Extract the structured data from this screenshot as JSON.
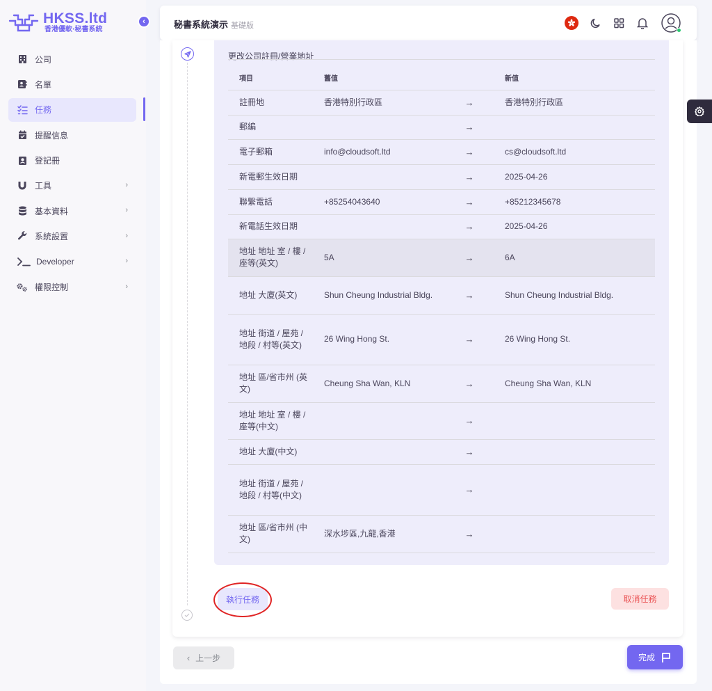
{
  "brand": {
    "name": "HKSS.ltd",
    "subtitle": "香港優軟‧秘書系統"
  },
  "sidebar": {
    "items": [
      {
        "label": "公司",
        "icon": "building-icon",
        "has_children": false
      },
      {
        "label": "名單",
        "icon": "contact-card-icon",
        "has_children": false
      },
      {
        "label": "任務",
        "icon": "checklist-icon",
        "has_children": false,
        "active": true
      },
      {
        "label": "提醒信息",
        "icon": "calendar-check-icon",
        "has_children": false
      },
      {
        "label": "登記冊",
        "icon": "register-book-icon",
        "has_children": false
      },
      {
        "label": "工具",
        "icon": "magnet-icon",
        "has_children": true
      },
      {
        "label": "基本資料",
        "icon": "database-icon",
        "has_children": true
      },
      {
        "label": "系統設置",
        "icon": "wrench-icon",
        "has_children": true
      },
      {
        "label": "Developer",
        "icon": "terminal-icon",
        "has_children": true
      },
      {
        "label": "權限控制",
        "icon": "gears-icon",
        "has_children": true
      }
    ]
  },
  "navbar": {
    "title": "秘書系統演示",
    "version": "基礎版"
  },
  "panel": {
    "title": "更改公司註冊/營業地址",
    "columns": {
      "item": "項目",
      "old": "舊值",
      "new": "新值"
    },
    "arrow": "→",
    "rows": [
      {
        "item": "註冊地",
        "old": "香港特別行政區",
        "new": "香港特別行政區"
      },
      {
        "item": "郵編",
        "old": "",
        "new": ""
      },
      {
        "item": "電子郵箱",
        "old": "info@cloudsoft.ltd",
        "new": "cs@cloudsoft.ltd"
      },
      {
        "item": "新電郵生效日期",
        "old": "",
        "new": "2025-04-26"
      },
      {
        "item": "聯繫電話",
        "old": "+85254043640",
        "new": "+85212345678"
      },
      {
        "item": "新電話生效日期",
        "old": "",
        "new": "2025-04-26"
      },
      {
        "item": "地址 地址 室 / 樓 / 座等(英文)",
        "old": "5A",
        "new": "6A",
        "highlighted": true
      },
      {
        "item": "地址 大廈(英文)",
        "old": "Shun Cheung Industrial Bldg.",
        "new": "Shun Cheung Industrial Bldg."
      },
      {
        "item": "地址 街道 / 屋苑 / 地段 / 村等(英文)",
        "old": "26 Wing Hong St.",
        "new": "26 Wing Hong St."
      },
      {
        "item": "地址 區/省市州 (英文)",
        "old": "Cheung Sha Wan, KLN",
        "new": "Cheung Sha Wan, KLN"
      },
      {
        "item": "地址 地址 室 / 樓 / 座等(中文)",
        "old": "",
        "new": ""
      },
      {
        "item": "地址 大廈(中文)",
        "old": "",
        "new": ""
      },
      {
        "item": "地址 街道 / 屋苑 / 地段 / 村等(中文)",
        "old": "",
        "new": ""
      },
      {
        "item": "地址 區/省市州 (中文)",
        "old": "深水埗區,九龍,香港",
        "new": ""
      }
    ]
  },
  "actions": {
    "execute": "執行任務",
    "cancel": "取消任務",
    "prev": "上一步",
    "done": "完成"
  },
  "colors": {
    "accent": "#7367f0",
    "danger": "#ea5455",
    "annotation": "#e02424"
  }
}
